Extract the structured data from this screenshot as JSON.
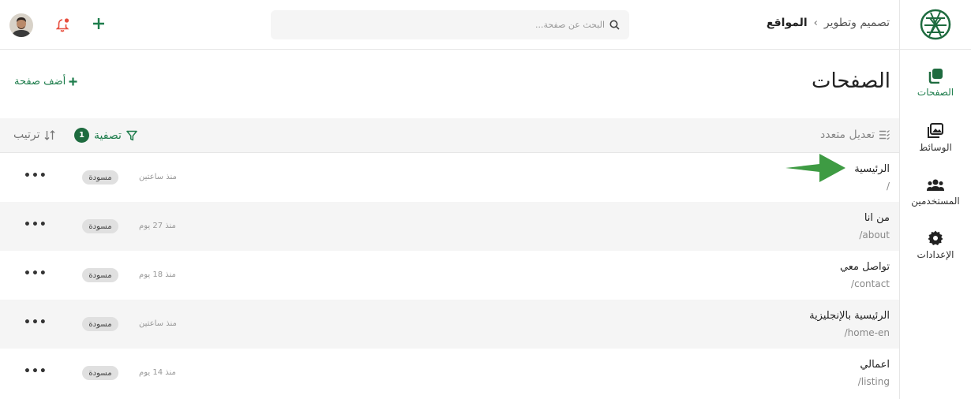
{
  "colors": {
    "accent": "#1e7d4c",
    "badge_bg": "#1e6b3f",
    "arrow": "#3e9b43",
    "bell": "#e74c3c"
  },
  "sidebar": {
    "logo_icon": "leaf-globe-logo",
    "items": [
      {
        "label": "الصفحات",
        "icon": "pages-icon",
        "active": true
      },
      {
        "label": "الوسائط",
        "icon": "media-icon",
        "active": false
      },
      {
        "label": "المستخدمين",
        "icon": "users-icon",
        "active": false
      },
      {
        "label": "الإعدادات",
        "icon": "settings-icon",
        "active": false
      }
    ]
  },
  "header": {
    "breadcrumb": {
      "root": "المواقع",
      "separator": "›",
      "current": "تصميم وتطوير"
    },
    "search_placeholder": "البحث عن صفحة..."
  },
  "main": {
    "title": "الصفحات",
    "add_page_label": "أضف صفحة",
    "toolbar": {
      "bulk_edit_label": "تعديل متعدد",
      "filter_label": "تصفية",
      "filter_count": "1",
      "sort_label": "ترتيب"
    },
    "rows": [
      {
        "title": "الرئيسية",
        "slug": "/",
        "time": "منذ ساعتين",
        "status": "مسودة"
      },
      {
        "title": "من انا",
        "slug": "/about",
        "time": "منذ 27 يوم",
        "status": "مسودة"
      },
      {
        "title": "تواصل معي",
        "slug": "/contact",
        "time": "منذ 18 يوم",
        "status": "مسودة"
      },
      {
        "title": "الرئيسية بالإنجليزية",
        "slug": "/home-en",
        "time": "منذ ساعتين",
        "status": "مسودة"
      },
      {
        "title": "اعمالي",
        "slug": "/listing",
        "time": "منذ 14 يوم",
        "status": "مسودة"
      }
    ],
    "more_label": "•••"
  }
}
